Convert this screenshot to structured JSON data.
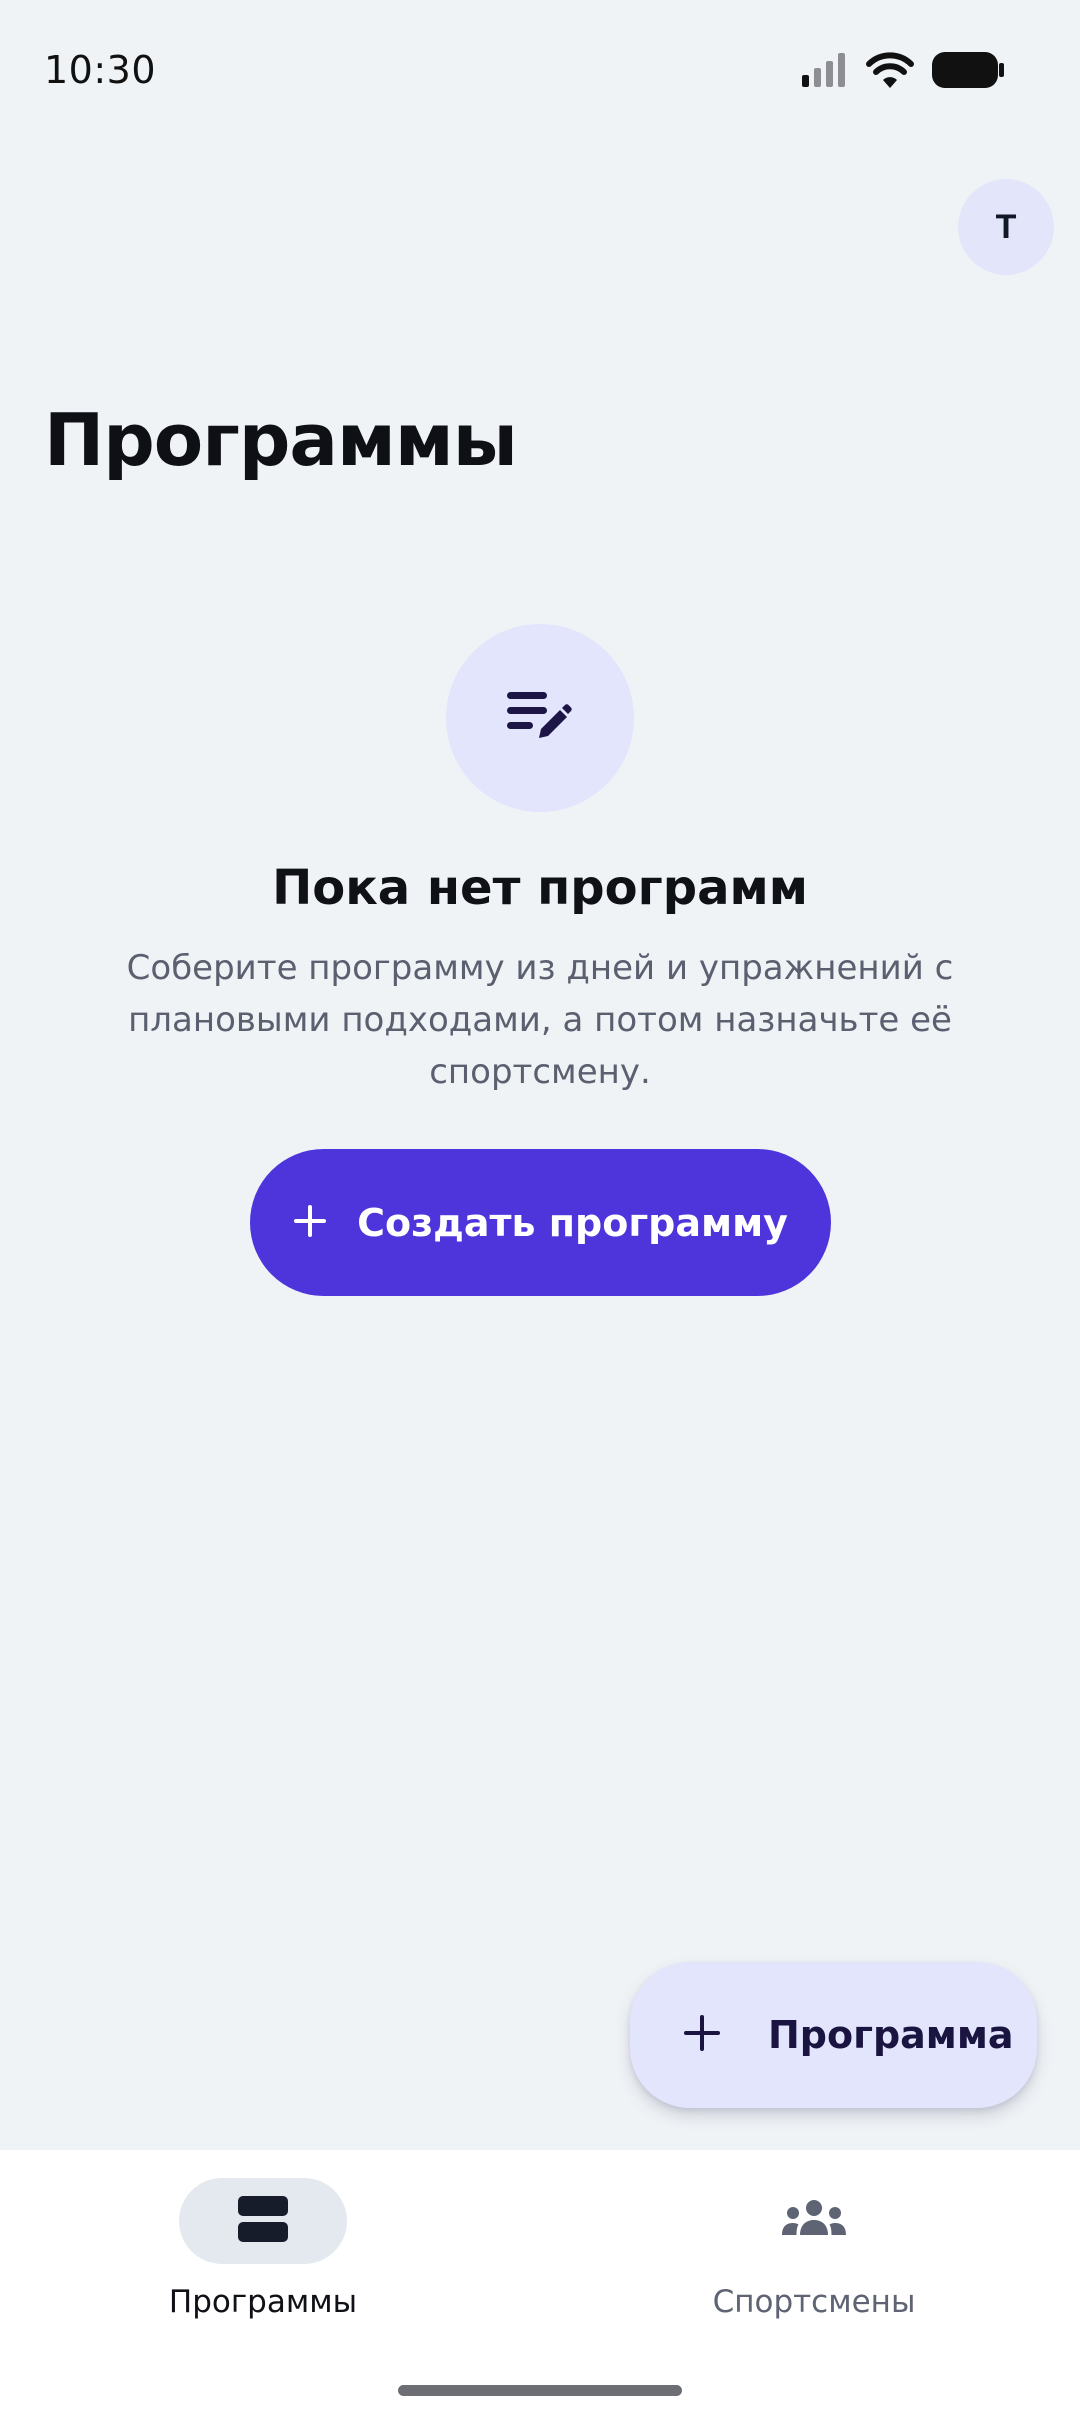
{
  "status_bar": {
    "time": "10:30",
    "icons": [
      "cellular-signal-icon",
      "wifi-icon",
      "battery-icon"
    ]
  },
  "header": {
    "avatar_initial": "T",
    "title": "Программы"
  },
  "empty_state": {
    "icon": "edit-note-icon",
    "title": "Пока нет программ",
    "description": "Соберите программу из дней и упражнений с плановыми подходами, а потом назначьте её спортсмену.",
    "button_label": "Создать программу",
    "button_icon": "plus-icon"
  },
  "fab": {
    "label": "Программа",
    "icon": "plus-icon"
  },
  "bottom_nav": {
    "items": [
      {
        "label": "Программы",
        "icon": "programs-icon",
        "active": true
      },
      {
        "label": "Спортсмены",
        "icon": "group-icon",
        "active": false
      }
    ]
  },
  "colors": {
    "background": "#f0f3f6",
    "accent": "#4d35db",
    "accent_light": "#e2e5fc",
    "nav_background": "#ffffff",
    "text_primary": "#0f1117",
    "text_secondary": "#5b6070"
  }
}
